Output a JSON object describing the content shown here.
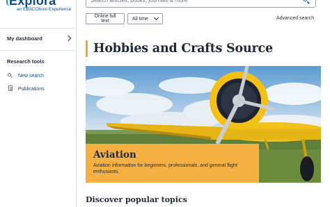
{
  "logo": {
    "main": "Explora",
    "sub": "an EBSCOhost Experience"
  },
  "sidebar": {
    "dashboard_label": "My dashboard",
    "research_heading": "Research tools",
    "items": [
      {
        "label": "New search",
        "icon": "search-icon"
      },
      {
        "label": "Publications",
        "icon": "document-icon"
      }
    ]
  },
  "search": {
    "placeholder": "Search articles, books, journals & more"
  },
  "filters": {
    "full_text": "Online full text",
    "time": "All time"
  },
  "advanced_search_label": "Advanced search",
  "page_title": "Hobbies and Crafts Source",
  "hero": {
    "title": "Aviation",
    "description": "Aviation information for beginners, professionals, and general flight enthusiasts."
  },
  "section_title": "Discover popular topics",
  "colors": {
    "accent": "#f6b042",
    "brand": "#0b4f8a",
    "link": "#1d6fb5"
  }
}
